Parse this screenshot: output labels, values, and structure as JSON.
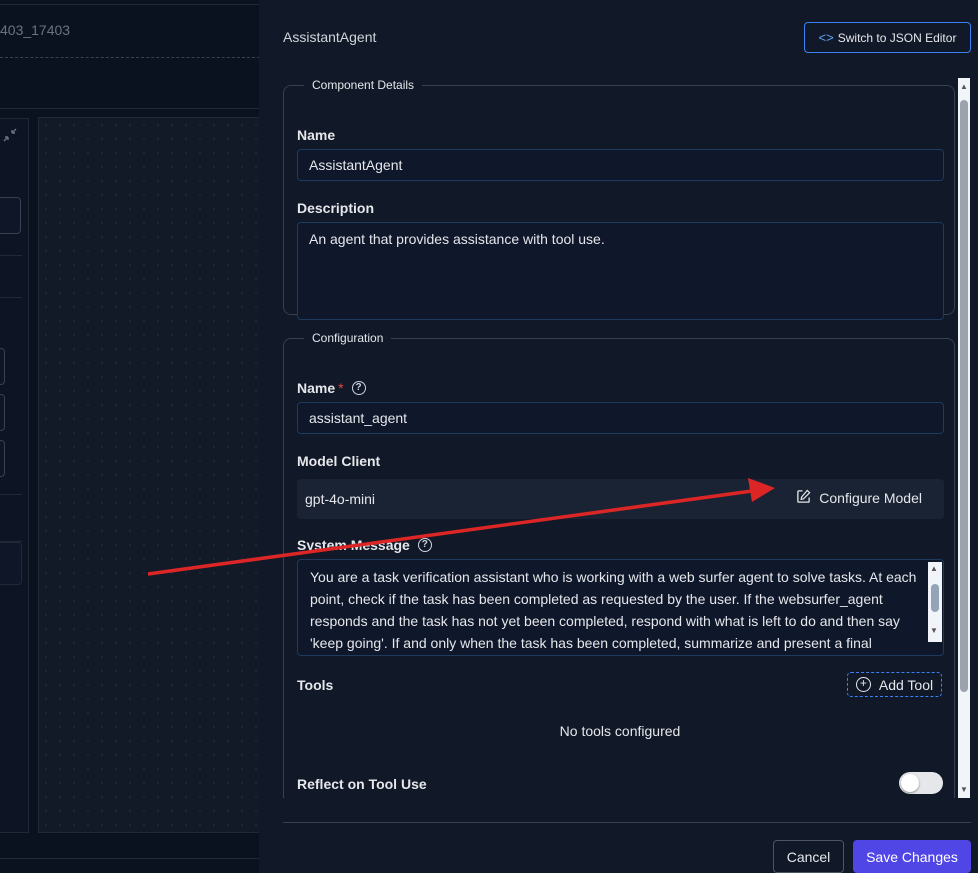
{
  "background": {
    "title_fragment": "403_17403",
    "collapse_icon": "collapse-icon"
  },
  "drawer": {
    "title": "AssistantAgent",
    "json_button_label": "Switch to JSON Editor"
  },
  "component_details": {
    "legend": "Component Details",
    "name_label": "Name",
    "name_value": "AssistantAgent",
    "description_label": "Description",
    "description_value": "An agent that provides assistance with tool use."
  },
  "configuration": {
    "legend": "Configuration",
    "name_label": "Name",
    "name_required": "*",
    "name_value": "assistant_agent",
    "model_client_label": "Model Client",
    "model_name": "gpt-4o-mini",
    "configure_label": "Configure Model",
    "system_message_label": "System Message",
    "system_message_value": "You are a task verification assistant who is working with a web surfer agent to solve tasks. At each point, check if the task has been completed as requested by the user. If the websurfer_agent responds and the task has not yet been completed, respond with what is left to do and then say 'keep going'. If and only when the task has been completed, summarize and present a final answer",
    "tools_label": "Tools",
    "add_tool_label": "Add Tool",
    "no_tools_text": "No tools configured",
    "reflect_label": "Reflect on Tool Use",
    "reflect_on": false
  },
  "footer": {
    "cancel_label": "Cancel",
    "save_label": "Save Changes"
  },
  "colors": {
    "annotation_arrow": "#dc2626",
    "primary_button": "#4f46e5",
    "accent_border": "#3b82f6"
  }
}
